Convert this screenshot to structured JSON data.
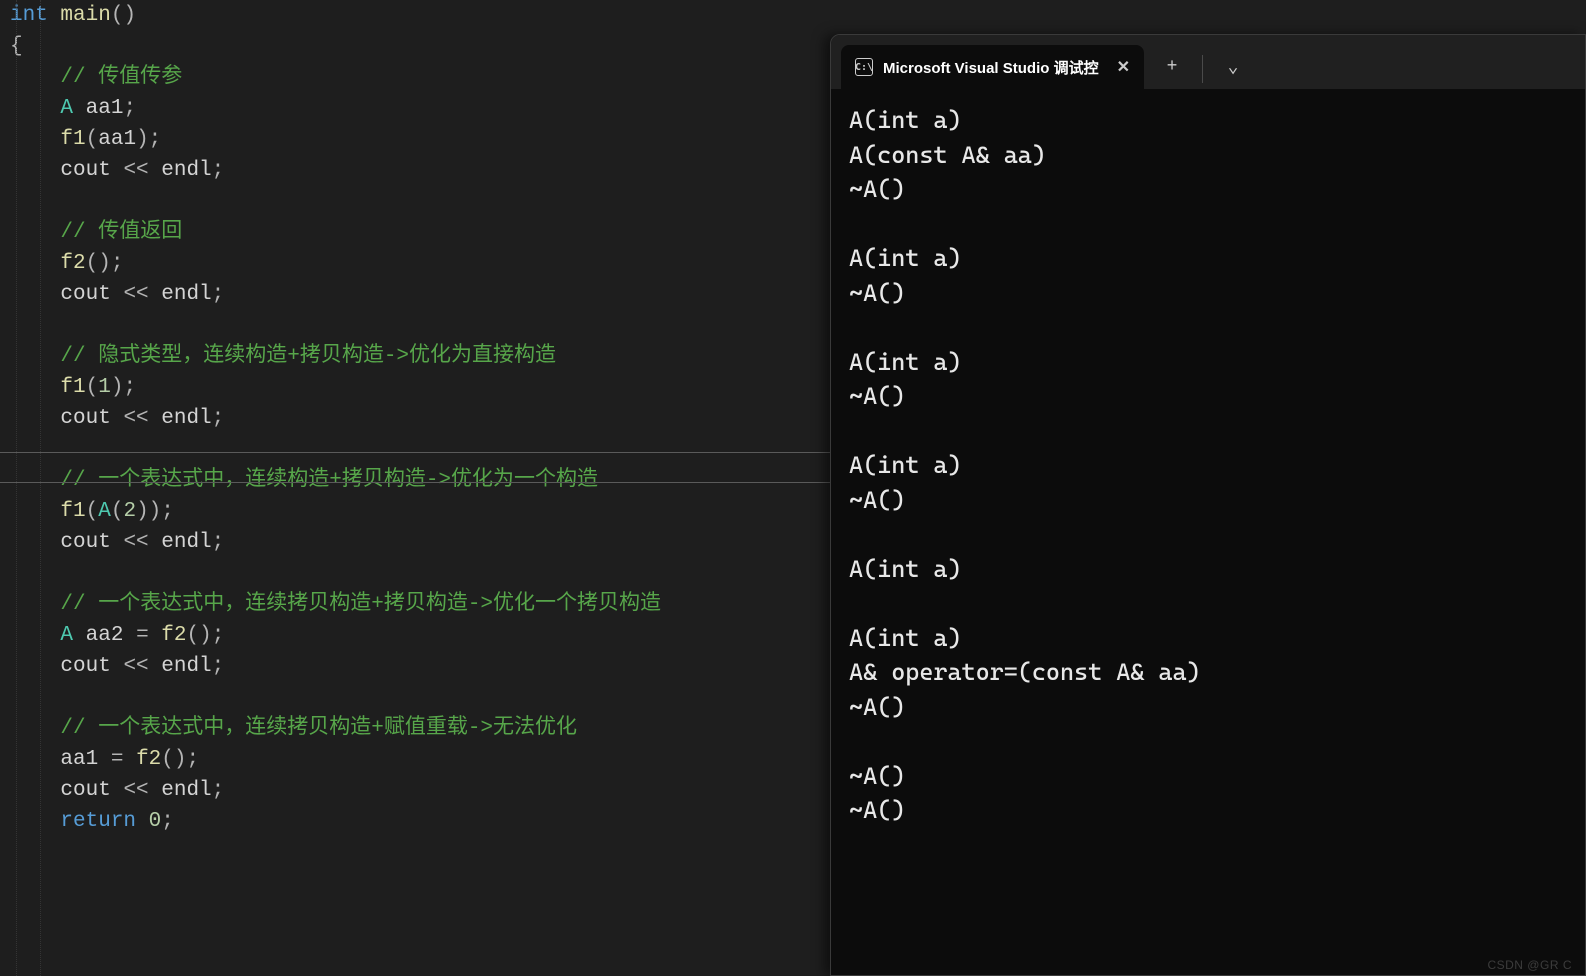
{
  "editor": {
    "lines": [
      {
        "t": "fn",
        "pre": "",
        "tokens": [
          {
            "c": "kw",
            "v": "int "
          },
          {
            "c": "fn",
            "v": "main"
          },
          {
            "c": "op",
            "v": "()"
          }
        ]
      },
      {
        "t": "plain",
        "pre": "",
        "tokens": [
          {
            "c": "op",
            "v": "{"
          }
        ]
      },
      {
        "t": "cmt",
        "pre": "    ",
        "v": "// 传值传参"
      },
      {
        "t": "stmt",
        "pre": "    ",
        "tokens": [
          {
            "c": "typ",
            "v": "A "
          },
          {
            "c": "txt",
            "v": "aa1"
          },
          {
            "c": "op",
            "v": ";"
          }
        ]
      },
      {
        "t": "stmt",
        "pre": "    ",
        "tokens": [
          {
            "c": "fn",
            "v": "f1"
          },
          {
            "c": "op",
            "v": "("
          },
          {
            "c": "txt",
            "v": "aa1"
          },
          {
            "c": "op",
            "v": ");"
          }
        ]
      },
      {
        "t": "stmt",
        "pre": "    ",
        "tokens": [
          {
            "c": "txt",
            "v": "cout "
          },
          {
            "c": "op",
            "v": "<< "
          },
          {
            "c": "txt",
            "v": "endl"
          },
          {
            "c": "op",
            "v": ";"
          }
        ]
      },
      {
        "t": "blank"
      },
      {
        "t": "cmt",
        "pre": "    ",
        "v": "// 传值返回"
      },
      {
        "t": "stmt",
        "pre": "    ",
        "tokens": [
          {
            "c": "fn",
            "v": "f2"
          },
          {
            "c": "op",
            "v": "();"
          }
        ]
      },
      {
        "t": "stmt",
        "pre": "    ",
        "tokens": [
          {
            "c": "txt",
            "v": "cout "
          },
          {
            "c": "op",
            "v": "<< "
          },
          {
            "c": "txt",
            "v": "endl"
          },
          {
            "c": "op",
            "v": ";"
          }
        ]
      },
      {
        "t": "blank"
      },
      {
        "t": "cmt",
        "pre": "    ",
        "v": "// 隐式类型，连续构造+拷贝构造->优化为直接构造"
      },
      {
        "t": "stmt",
        "pre": "    ",
        "tokens": [
          {
            "c": "fn",
            "v": "f1"
          },
          {
            "c": "op",
            "v": "("
          },
          {
            "c": "num",
            "v": "1"
          },
          {
            "c": "op",
            "v": ");"
          }
        ]
      },
      {
        "t": "stmt",
        "pre": "    ",
        "tokens": [
          {
            "c": "txt",
            "v": "cout "
          },
          {
            "c": "op",
            "v": "<< "
          },
          {
            "c": "txt",
            "v": "endl"
          },
          {
            "c": "op",
            "v": ";"
          }
        ]
      },
      {
        "t": "blank"
      },
      {
        "t": "cmt",
        "pre": "    ",
        "v": "// 一个表达式中，连续构造+拷贝构造->优化为一个构造"
      },
      {
        "t": "stmt",
        "pre": "    ",
        "tokens": [
          {
            "c": "fn",
            "v": "f1"
          },
          {
            "c": "op",
            "v": "("
          },
          {
            "c": "typ",
            "v": "A"
          },
          {
            "c": "op",
            "v": "("
          },
          {
            "c": "num",
            "v": "2"
          },
          {
            "c": "op",
            "v": "));"
          }
        ]
      },
      {
        "t": "stmt",
        "pre": "    ",
        "tokens": [
          {
            "c": "txt",
            "v": "cout "
          },
          {
            "c": "op",
            "v": "<< "
          },
          {
            "c": "txt",
            "v": "endl"
          },
          {
            "c": "op",
            "v": ";"
          }
        ]
      },
      {
        "t": "blank"
      },
      {
        "t": "cmt",
        "pre": "    ",
        "v": "// 一个表达式中，连续拷贝构造+拷贝构造->优化一个拷贝构造"
      },
      {
        "t": "stmt",
        "pre": "    ",
        "tokens": [
          {
            "c": "typ",
            "v": "A "
          },
          {
            "c": "txt",
            "v": "aa2 "
          },
          {
            "c": "op",
            "v": "= "
          },
          {
            "c": "fn",
            "v": "f2"
          },
          {
            "c": "op",
            "v": "();"
          }
        ]
      },
      {
        "t": "stmt",
        "pre": "    ",
        "tokens": [
          {
            "c": "txt",
            "v": "cout "
          },
          {
            "c": "op",
            "v": "<< "
          },
          {
            "c": "txt",
            "v": "endl"
          },
          {
            "c": "op",
            "v": ";"
          }
        ]
      },
      {
        "t": "blank"
      },
      {
        "t": "cmt",
        "pre": "    ",
        "v": "// 一个表达式中，连续拷贝构造+赋值重载->无法优化"
      },
      {
        "t": "stmt",
        "pre": "    ",
        "tokens": [
          {
            "c": "txt",
            "v": "aa1 "
          },
          {
            "c": "op",
            "v": "= "
          },
          {
            "c": "fn",
            "v": "f2"
          },
          {
            "c": "op",
            "v": "();"
          }
        ]
      },
      {
        "t": "stmt",
        "pre": "    ",
        "tokens": [
          {
            "c": "txt",
            "v": "cout "
          },
          {
            "c": "op",
            "v": "<< "
          },
          {
            "c": "txt",
            "v": "endl"
          },
          {
            "c": "op",
            "v": ";"
          }
        ]
      },
      {
        "t": "stmt",
        "pre": "    ",
        "tokens": [
          {
            "c": "kw",
            "v": "return "
          },
          {
            "c": "num",
            "v": "0"
          },
          {
            "c": "op",
            "v": ";"
          }
        ]
      }
    ]
  },
  "terminal": {
    "tab_title": "Microsoft Visual Studio 调试控",
    "tab_icon_text": "C:\\",
    "output": [
      "A(int a)",
      "A(const A& aa)",
      "~A()",
      "",
      "A(int a)",
      "~A()",
      "",
      "A(int a)",
      "~A()",
      "",
      "A(int a)",
      "~A()",
      "",
      "A(int a)",
      "",
      "A(int a)",
      "A& operator=(const A& aa)",
      "~A()",
      "",
      "~A()",
      "~A()"
    ],
    "add_label": "+",
    "dropdown_label": "⌄"
  },
  "watermark": "CSDN @GR C"
}
